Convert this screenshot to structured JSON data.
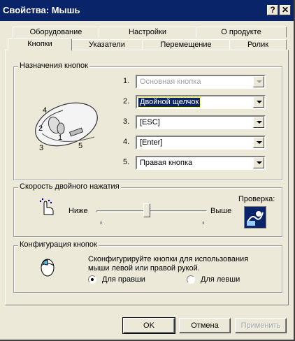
{
  "window": {
    "title": "Свойства: Мышь",
    "help_btn": "?",
    "close_btn": "✕"
  },
  "tabs_back": [
    "Оборудование",
    "Настройки",
    "О продукте"
  ],
  "tabs_front": [
    "Кнопки",
    "Указатели",
    "Перемещение",
    "Ролик"
  ],
  "assign": {
    "legend": "Назначения кнопок",
    "mouse_labels": [
      "4",
      "2",
      "1",
      "3",
      "5"
    ],
    "rows": [
      {
        "num": "1.",
        "value": "Основная кнопка"
      },
      {
        "num": "2.",
        "value": "Двойной щелчок"
      },
      {
        "num": "3.",
        "value": "[ESC]"
      },
      {
        "num": "4.",
        "value": "[Enter]"
      },
      {
        "num": "5.",
        "value": "Правая кнопка"
      }
    ]
  },
  "speed": {
    "legend": "Скорость двойного нажатия",
    "slow": "Ниже",
    "fast": "Выше",
    "test": "Проверка:",
    "level": 0.45
  },
  "config": {
    "legend": "Конфигурация кнопок",
    "desc": "Сконфигурируйте кнопки для использования мыши левой или правой рукой.",
    "right": "Для правши",
    "left": "Для левши"
  },
  "buttons": {
    "ok": "OK",
    "cancel": "Отмена",
    "apply": "Применить"
  }
}
